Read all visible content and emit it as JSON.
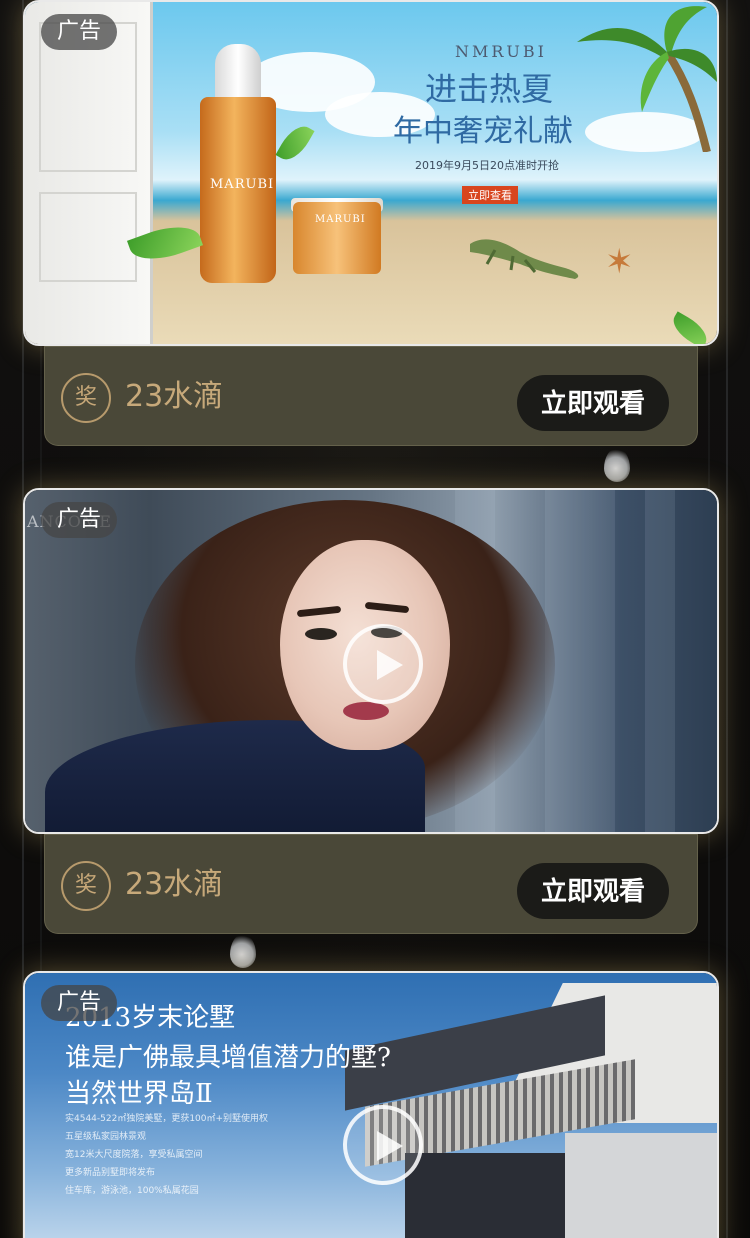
{
  "ads": [
    {
      "badge": "广告",
      "kind": "image",
      "creative": {
        "brand": "NMRUBI",
        "headline_1": "进击热夏",
        "headline_2": "年中奢宠礼献",
        "date_line": "2019年9月5日20点准时开抢",
        "cta": "立即查看",
        "product_brand_1": "MARUBI",
        "product_brand_2": "MARUBI"
      },
      "reward": {
        "icon_label": "奖",
        "text": "23水滴"
      },
      "action_label": "立即观看"
    },
    {
      "badge": "广告",
      "kind": "video",
      "creative": {
        "ghost_brand": "ANCOME"
      },
      "play_icon": "play-circle-icon",
      "reward": {
        "icon_label": "奖",
        "text": "23水滴"
      },
      "action_label": "立即观看"
    },
    {
      "badge": "广告",
      "kind": "video",
      "creative": {
        "title": "2013岁末论墅",
        "line_1": "谁是广佛最具增值潜力的墅?",
        "line_2": "当然世界岛Ⅱ",
        "small_lines": [
          "实4544-522㎡独院美墅，更获100㎡+别墅使用权",
          "五星级私家园林景观",
          "宽12米大尺度院落，享受私属空间",
          "更多新品别墅即将发布",
          "住车库，游泳池，100%私属花园"
        ]
      },
      "play_icon": "play-circle-icon"
    }
  ]
}
